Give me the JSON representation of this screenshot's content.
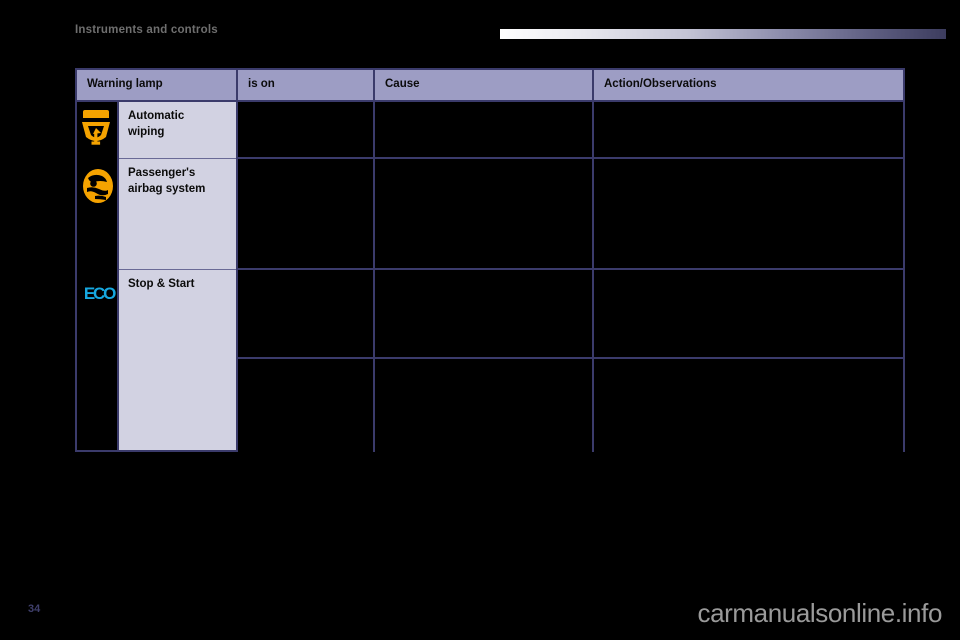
{
  "page": {
    "section_title": "Instruments and controls",
    "page_number": "34",
    "watermark": "carmanualsonline.info",
    "background_color": "#000000",
    "accent_color": "#3b3b6b",
    "header_fill": "#9d9dc4",
    "label_fill": "#d2d2e2"
  },
  "table": {
    "columns": [
      {
        "key": "warning_lamp",
        "label": "Warning lamp"
      },
      {
        "key": "is_on",
        "label": "is on"
      },
      {
        "key": "cause",
        "label": "Cause"
      },
      {
        "key": "action",
        "label": "Action/Observations"
      }
    ],
    "lamps": [
      {
        "icon": "automatic-wiping-lamp-icon",
        "icon_color": "#f5a300",
        "label": "Automatic\nwiping",
        "label_line1": "Automatic",
        "label_line2": "wiping"
      },
      {
        "icon": "passenger-airbag-lamp-icon",
        "icon_color": "#f5a300",
        "label": "Passenger's\nairbag system",
        "label_line1": "Passenger's",
        "label_line2": "airbag system"
      },
      {
        "icon": "eco-stop-start-lamp-icon",
        "icon_color": "#16a8e0",
        "icon_text": "ECO",
        "label": "Stop & Start",
        "label_line1": "Stop & Start",
        "label_line2": ""
      }
    ],
    "rows": [
      {
        "is_on": "",
        "cause": "",
        "action": ""
      },
      {
        "is_on": "",
        "cause": "",
        "action": ""
      },
      {
        "is_on": "",
        "cause": "",
        "action": ""
      },
      {
        "is_on": "",
        "cause": "",
        "action": ""
      }
    ]
  }
}
